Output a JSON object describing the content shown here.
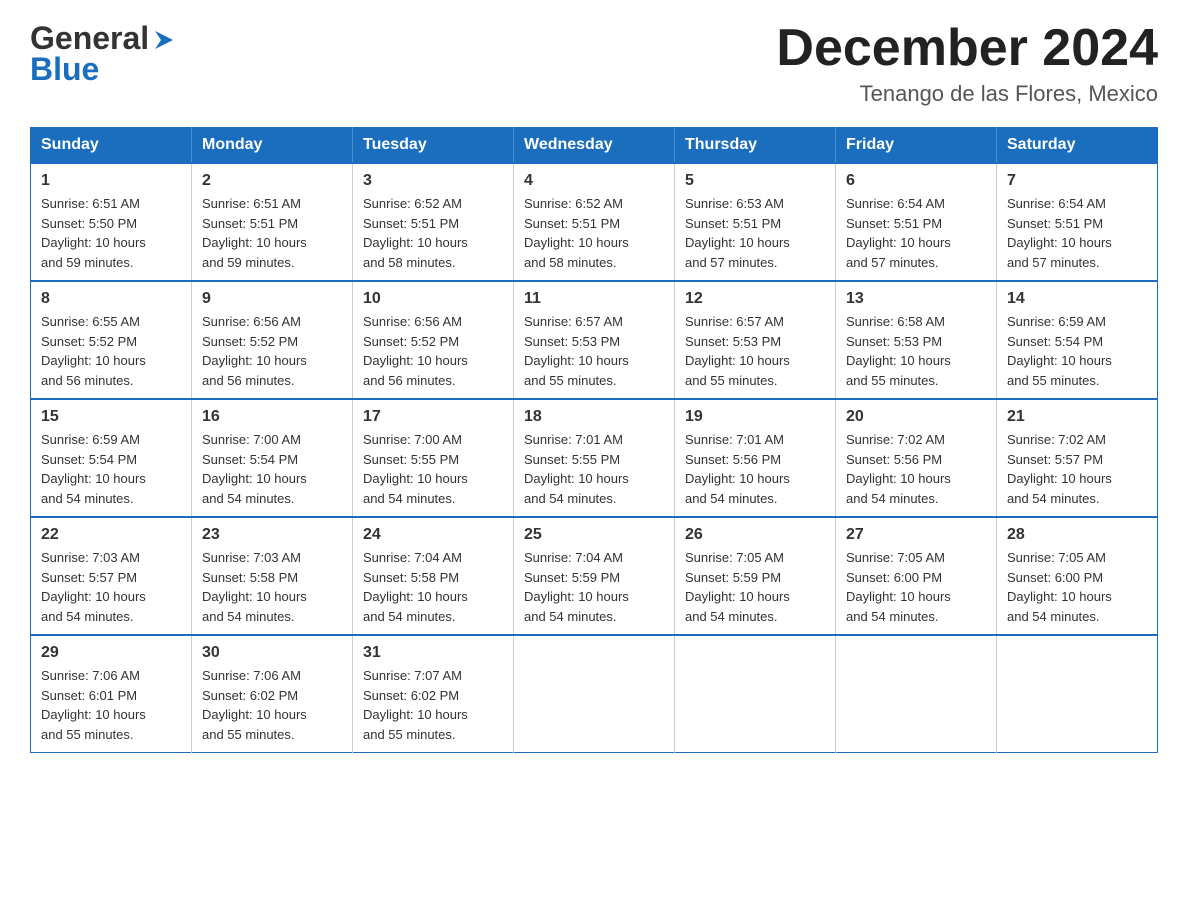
{
  "header": {
    "logo_general": "General",
    "logo_blue": "Blue",
    "month_title": "December 2024",
    "location": "Tenango de las Flores, Mexico"
  },
  "weekdays": [
    "Sunday",
    "Monday",
    "Tuesday",
    "Wednesday",
    "Thursday",
    "Friday",
    "Saturday"
  ],
  "weeks": [
    [
      {
        "day": "1",
        "sunrise": "6:51 AM",
        "sunset": "5:50 PM",
        "daylight": "10 hours and 59 minutes."
      },
      {
        "day": "2",
        "sunrise": "6:51 AM",
        "sunset": "5:51 PM",
        "daylight": "10 hours and 59 minutes."
      },
      {
        "day": "3",
        "sunrise": "6:52 AM",
        "sunset": "5:51 PM",
        "daylight": "10 hours and 58 minutes."
      },
      {
        "day": "4",
        "sunrise": "6:52 AM",
        "sunset": "5:51 PM",
        "daylight": "10 hours and 58 minutes."
      },
      {
        "day": "5",
        "sunrise": "6:53 AM",
        "sunset": "5:51 PM",
        "daylight": "10 hours and 57 minutes."
      },
      {
        "day": "6",
        "sunrise": "6:54 AM",
        "sunset": "5:51 PM",
        "daylight": "10 hours and 57 minutes."
      },
      {
        "day": "7",
        "sunrise": "6:54 AM",
        "sunset": "5:51 PM",
        "daylight": "10 hours and 57 minutes."
      }
    ],
    [
      {
        "day": "8",
        "sunrise": "6:55 AM",
        "sunset": "5:52 PM",
        "daylight": "10 hours and 56 minutes."
      },
      {
        "day": "9",
        "sunrise": "6:56 AM",
        "sunset": "5:52 PM",
        "daylight": "10 hours and 56 minutes."
      },
      {
        "day": "10",
        "sunrise": "6:56 AM",
        "sunset": "5:52 PM",
        "daylight": "10 hours and 56 minutes."
      },
      {
        "day": "11",
        "sunrise": "6:57 AM",
        "sunset": "5:53 PM",
        "daylight": "10 hours and 55 minutes."
      },
      {
        "day": "12",
        "sunrise": "6:57 AM",
        "sunset": "5:53 PM",
        "daylight": "10 hours and 55 minutes."
      },
      {
        "day": "13",
        "sunrise": "6:58 AM",
        "sunset": "5:53 PM",
        "daylight": "10 hours and 55 minutes."
      },
      {
        "day": "14",
        "sunrise": "6:59 AM",
        "sunset": "5:54 PM",
        "daylight": "10 hours and 55 minutes."
      }
    ],
    [
      {
        "day": "15",
        "sunrise": "6:59 AM",
        "sunset": "5:54 PM",
        "daylight": "10 hours and 54 minutes."
      },
      {
        "day": "16",
        "sunrise": "7:00 AM",
        "sunset": "5:54 PM",
        "daylight": "10 hours and 54 minutes."
      },
      {
        "day": "17",
        "sunrise": "7:00 AM",
        "sunset": "5:55 PM",
        "daylight": "10 hours and 54 minutes."
      },
      {
        "day": "18",
        "sunrise": "7:01 AM",
        "sunset": "5:55 PM",
        "daylight": "10 hours and 54 minutes."
      },
      {
        "day": "19",
        "sunrise": "7:01 AM",
        "sunset": "5:56 PM",
        "daylight": "10 hours and 54 minutes."
      },
      {
        "day": "20",
        "sunrise": "7:02 AM",
        "sunset": "5:56 PM",
        "daylight": "10 hours and 54 minutes."
      },
      {
        "day": "21",
        "sunrise": "7:02 AM",
        "sunset": "5:57 PM",
        "daylight": "10 hours and 54 minutes."
      }
    ],
    [
      {
        "day": "22",
        "sunrise": "7:03 AM",
        "sunset": "5:57 PM",
        "daylight": "10 hours and 54 minutes."
      },
      {
        "day": "23",
        "sunrise": "7:03 AM",
        "sunset": "5:58 PM",
        "daylight": "10 hours and 54 minutes."
      },
      {
        "day": "24",
        "sunrise": "7:04 AM",
        "sunset": "5:58 PM",
        "daylight": "10 hours and 54 minutes."
      },
      {
        "day": "25",
        "sunrise": "7:04 AM",
        "sunset": "5:59 PM",
        "daylight": "10 hours and 54 minutes."
      },
      {
        "day": "26",
        "sunrise": "7:05 AM",
        "sunset": "5:59 PM",
        "daylight": "10 hours and 54 minutes."
      },
      {
        "day": "27",
        "sunrise": "7:05 AM",
        "sunset": "6:00 PM",
        "daylight": "10 hours and 54 minutes."
      },
      {
        "day": "28",
        "sunrise": "7:05 AM",
        "sunset": "6:00 PM",
        "daylight": "10 hours and 54 minutes."
      }
    ],
    [
      {
        "day": "29",
        "sunrise": "7:06 AM",
        "sunset": "6:01 PM",
        "daylight": "10 hours and 55 minutes."
      },
      {
        "day": "30",
        "sunrise": "7:06 AM",
        "sunset": "6:02 PM",
        "daylight": "10 hours and 55 minutes."
      },
      {
        "day": "31",
        "sunrise": "7:07 AM",
        "sunset": "6:02 PM",
        "daylight": "10 hours and 55 minutes."
      },
      null,
      null,
      null,
      null
    ]
  ],
  "labels": {
    "sunrise": "Sunrise:",
    "sunset": "Sunset:",
    "daylight": "Daylight:"
  }
}
